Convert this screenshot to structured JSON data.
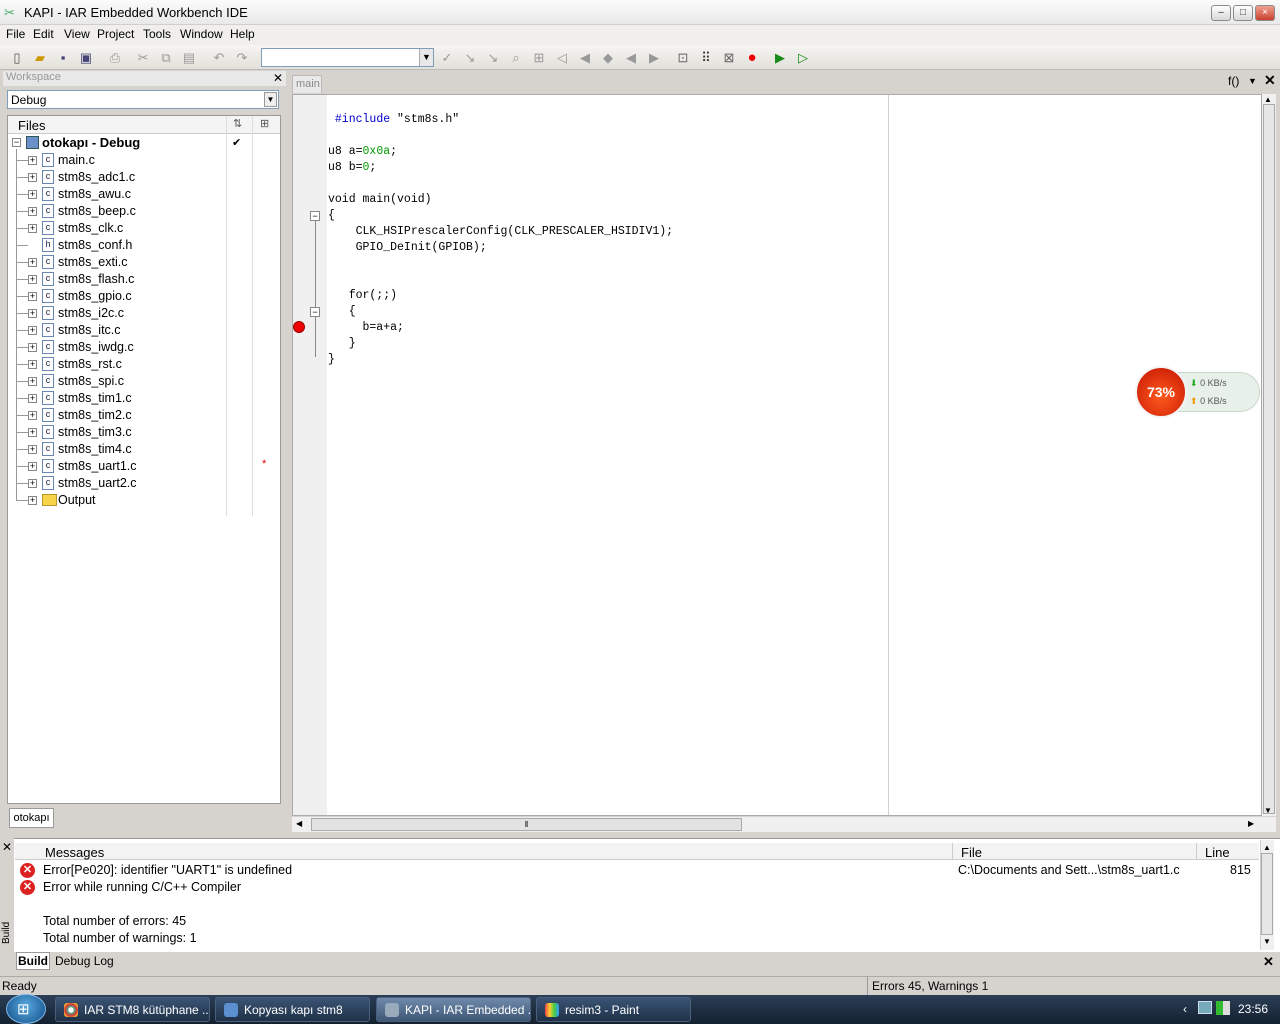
{
  "window": {
    "title": "KAPI - IAR Embedded Workbench IDE",
    "buttons": {
      "minimize": "–",
      "maximize": "□",
      "close": "×"
    }
  },
  "menu": [
    "File",
    "Edit",
    "View",
    "Project",
    "Tools",
    "Window",
    "Help"
  ],
  "workspace": {
    "title": "Workspace",
    "config": "Debug",
    "files_header": "Files",
    "root": "otokapı - Debug",
    "root_check": "✔",
    "tab": "otokapı",
    "items": [
      {
        "name": "main.c",
        "type": "c"
      },
      {
        "name": "stm8s_adc1.c",
        "type": "c"
      },
      {
        "name": "stm8s_awu.c",
        "type": "c"
      },
      {
        "name": "stm8s_beep.c",
        "type": "c"
      },
      {
        "name": "stm8s_clk.c",
        "type": "c"
      },
      {
        "name": "stm8s_conf.h",
        "type": "h"
      },
      {
        "name": "stm8s_exti.c",
        "type": "c"
      },
      {
        "name": "stm8s_flash.c",
        "type": "c"
      },
      {
        "name": "stm8s_gpio.c",
        "type": "c"
      },
      {
        "name": "stm8s_i2c.c",
        "type": "c"
      },
      {
        "name": "stm8s_itc.c",
        "type": "c"
      },
      {
        "name": "stm8s_iwdg.c",
        "type": "c"
      },
      {
        "name": "stm8s_rst.c",
        "type": "c"
      },
      {
        "name": "stm8s_spi.c",
        "type": "c"
      },
      {
        "name": "stm8s_tim1.c",
        "type": "c"
      },
      {
        "name": "stm8s_tim2.c",
        "type": "c"
      },
      {
        "name": "stm8s_tim3.c",
        "type": "c"
      },
      {
        "name": "stm8s_tim4.c",
        "type": "c"
      },
      {
        "name": "stm8s_uart1.c",
        "type": "c",
        "modified": "*"
      },
      {
        "name": "stm8s_uart2.c",
        "type": "c"
      },
      {
        "name": "Output",
        "type": "folder"
      }
    ]
  },
  "editor": {
    "tab": "main",
    "func_label": "f()",
    "lines": [
      " #include \"stm8s.h\"",
      "",
      "u8 a=0x0a;",
      "u8 b=0;",
      "",
      "void main(void)",
      "{",
      "    CLK_HSIPrescalerConfig(CLK_PRESCALER_HSIDIV1);",
      "    GPIO_DeInit(GPIOB);",
      "",
      "",
      "   for(;;)",
      "   {",
      "     b=a+a;",
      "   }",
      "}"
    ]
  },
  "network": {
    "percent": "73%",
    "down": "0 KB/s",
    "up": "0 KB/s"
  },
  "messages": {
    "headers": {
      "messages": "Messages",
      "file": "File",
      "line": "Line"
    },
    "rows": [
      {
        "text": "Error[Pe020]: identifier \"UART1\" is undefined",
        "file": "C:\\Documents and Sett...\\stm8s_uart1.c",
        "line": "815",
        "error": true
      },
      {
        "text": "Error while running C/C++ Compiler",
        "file": "",
        "line": "",
        "error": true
      },
      {
        "text": "",
        "file": "",
        "line": "",
        "error": false
      },
      {
        "text": "Total number of errors: 45",
        "file": "",
        "line": "",
        "error": false
      },
      {
        "text": "Total number of warnings: 1",
        "file": "",
        "line": "",
        "error": false
      }
    ],
    "side_label": "Build",
    "tabs": [
      "Build",
      "Debug Log"
    ]
  },
  "status": {
    "left": "Ready",
    "right": "Errors 45, Warnings 1"
  },
  "taskbar": {
    "items": [
      "IAR STM8 kütüphane ...",
      "Kopyası kapı stm8",
      "KAPI - IAR Embedded ...",
      "resim3 - Paint"
    ],
    "clock": "23:56"
  }
}
